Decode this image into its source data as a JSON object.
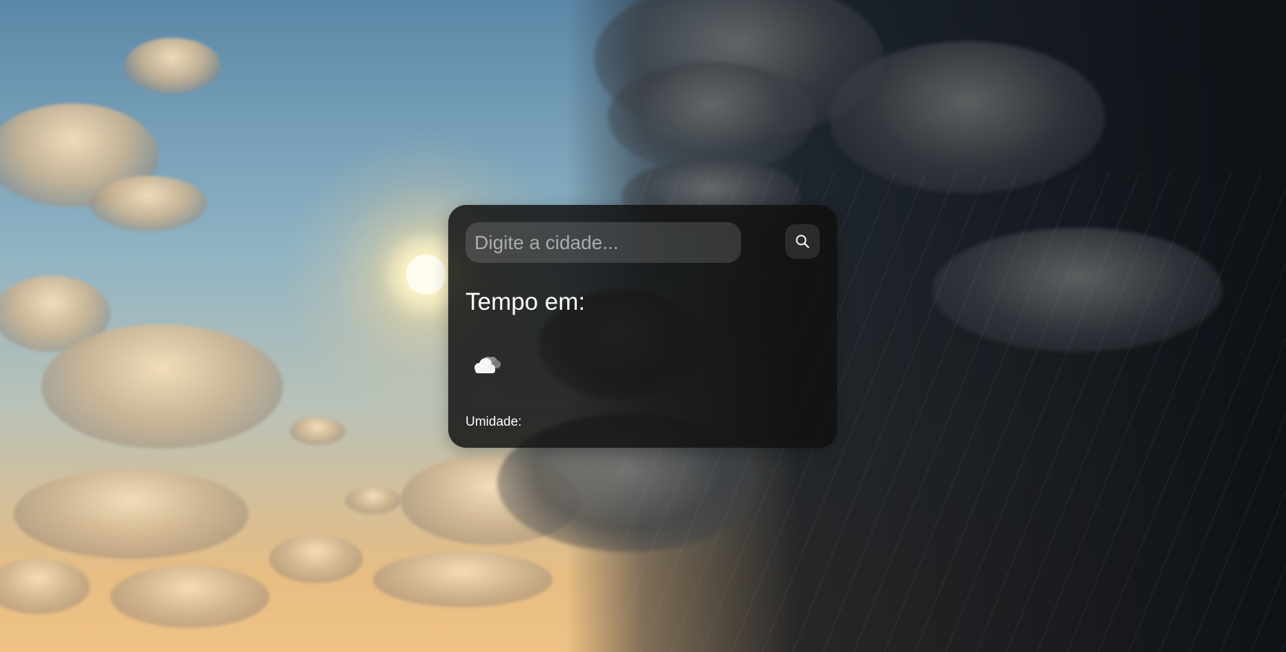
{
  "search": {
    "placeholder": "Digite a cidade...",
    "value": "",
    "button_icon": "search-icon"
  },
  "weather": {
    "title": "Tempo em:",
    "icon": "cloud-icon",
    "humidity_label": "Umidade:"
  },
  "colors": {
    "card_background": "#101010",
    "text": "#ffffff",
    "input_background": "#3a3a3a"
  }
}
